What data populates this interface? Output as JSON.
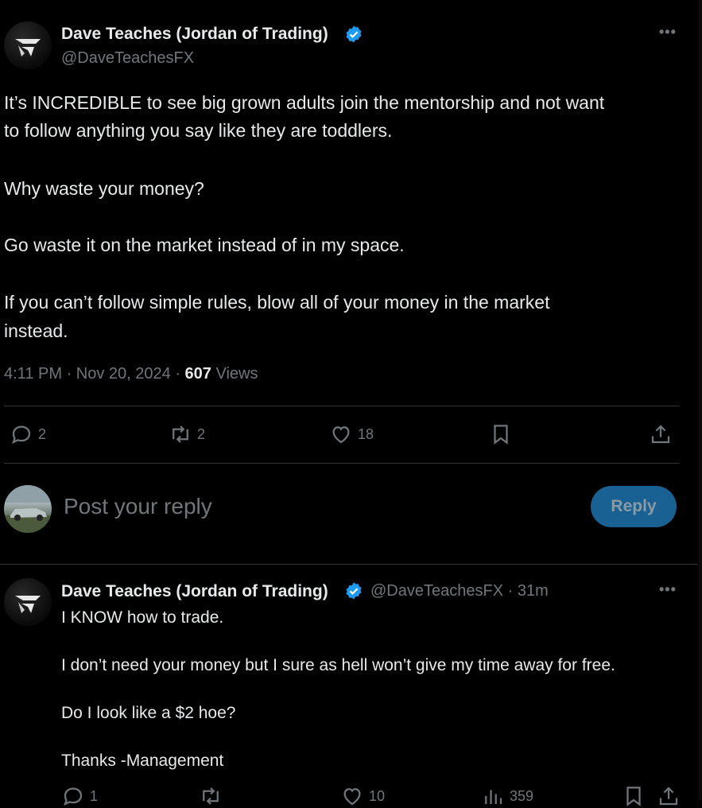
{
  "tweet": {
    "author_name": "Dave Teaches (Jordan of Trading)",
    "handle": "@DaveTeachesFX",
    "lines": [
      "It’s INCREDIBLE to see big grown adults join the mentorship and not want",
      "to follow anything you say like they are toddlers.",
      "Why waste your money?",
      "Go waste it on the market instead of in my space.",
      "If you can’t follow simple rules, blow all of your money in the market",
      "instead."
    ],
    "time": "4:11 PM",
    "date": "Nov 20, 2024",
    "views_count": "607",
    "views_label": "Views",
    "replies": "2",
    "retweets": "2",
    "likes": "18"
  },
  "composer": {
    "placeholder": "Post your reply",
    "button_label": "Reply"
  },
  "reply": {
    "author_name": "Dave Teaches (Jordan of Trading)",
    "handle": "@DaveTeachesFX",
    "age": "31m",
    "lines": [
      "I KNOW how to trade.",
      "I don’t need your money but I sure as hell won’t give my time away for free.",
      "Do I look like a $2 hoe?",
      "Thanks -Management"
    ],
    "replies": "1",
    "likes": "10",
    "views": "359"
  },
  "colors": {
    "background": "#000000",
    "text": "#e7e9ea",
    "muted": "#71767b",
    "verified": "#1d9bf0",
    "reply_button": "#1a6193"
  },
  "icons": [
    "more-icon",
    "verified-icon",
    "reply-icon",
    "retweet-icon",
    "like-icon",
    "bookmark-icon",
    "share-icon",
    "views-icon"
  ]
}
